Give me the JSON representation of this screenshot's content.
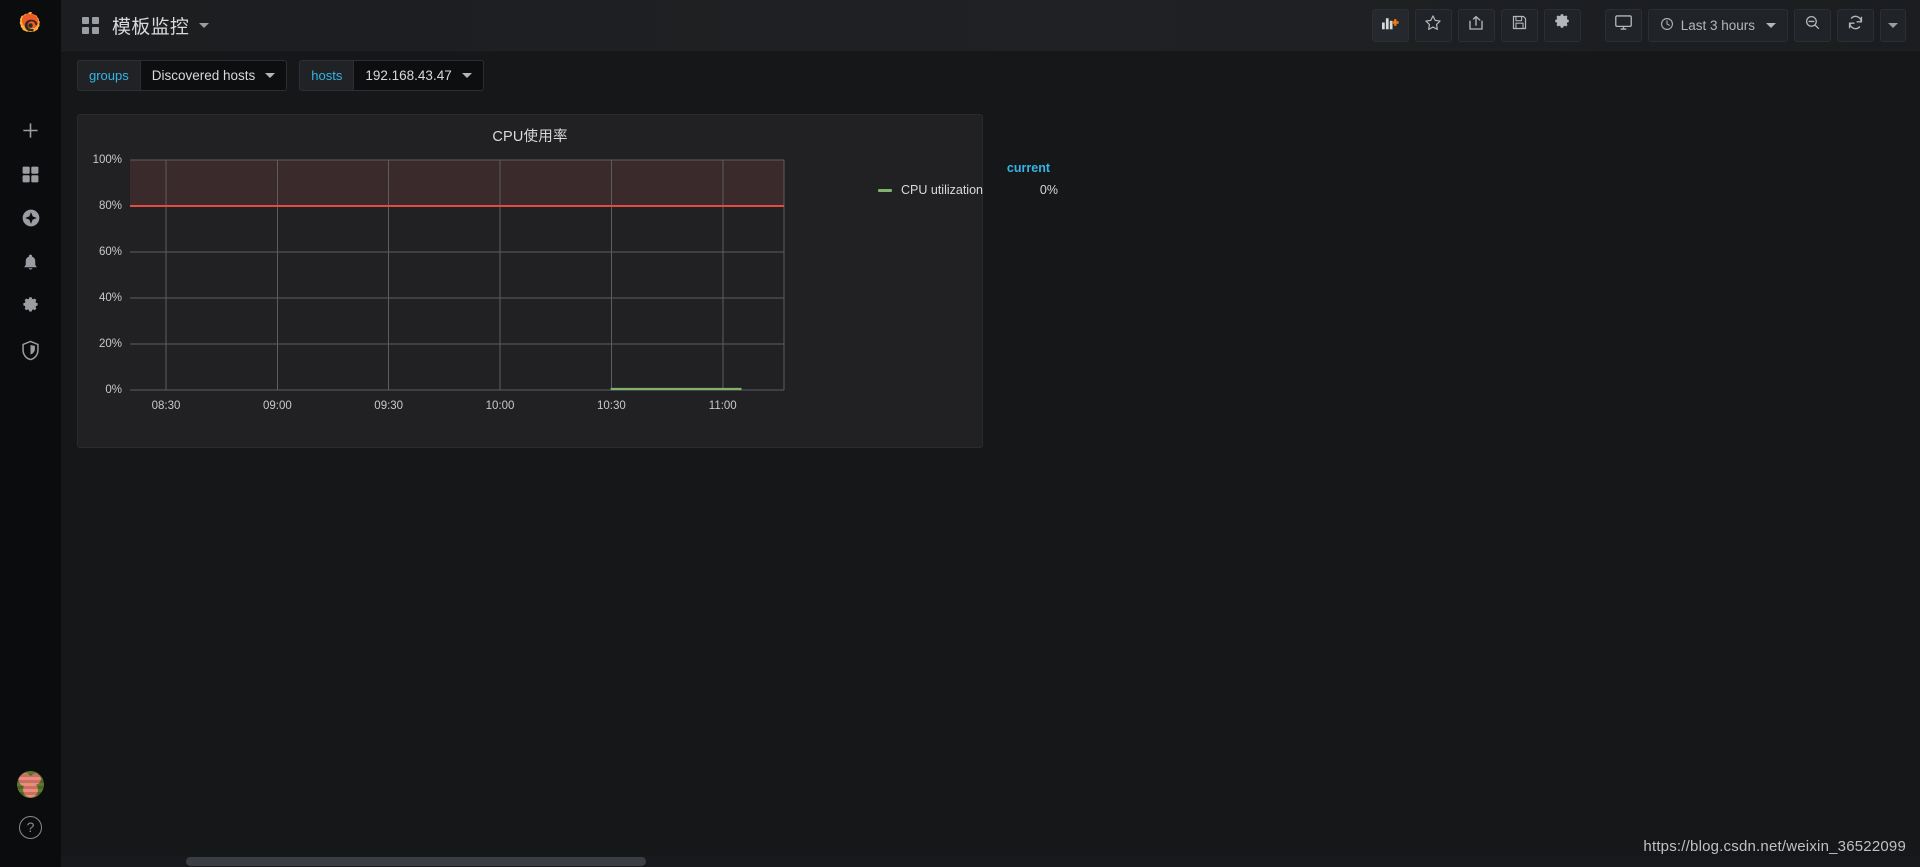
{
  "app": {
    "logo_icon": "grafana-logo-icon",
    "brand_colors": {
      "orange": "#f05a28",
      "yellow": "#fbb03b"
    }
  },
  "sidebar": {
    "items": [
      {
        "id": "create",
        "icon": "plus-icon",
        "label": "Create"
      },
      {
        "id": "dashboards",
        "icon": "dashboards-grid-icon",
        "label": "Dashboards"
      },
      {
        "id": "explore",
        "icon": "compass-icon",
        "label": "Explore"
      },
      {
        "id": "alerting",
        "icon": "bell-icon",
        "label": "Alerting"
      },
      {
        "id": "configuration",
        "icon": "gear-icon",
        "label": "Configuration"
      },
      {
        "id": "server-admin",
        "icon": "shield-icon",
        "label": "Server Admin"
      }
    ],
    "bottom": {
      "avatar": {
        "icon": "avatar",
        "label": "User profile"
      },
      "help": {
        "icon": "help-icon",
        "label": "?"
      }
    }
  },
  "topnav": {
    "dashboard_icon": "dashboards-grid-icon",
    "title": "模板监控",
    "title_caret_icon": "chevron-down-icon",
    "buttons": [
      {
        "id": "add-panel",
        "icon": "add-panel-icon",
        "label": "Add panel"
      },
      {
        "id": "star",
        "icon": "star-icon",
        "label": "Mark as favorite"
      },
      {
        "id": "share",
        "icon": "share-icon",
        "label": "Share dashboard"
      },
      {
        "id": "save",
        "icon": "save-icon",
        "label": "Save dashboard"
      },
      {
        "id": "settings",
        "icon": "gear-icon",
        "label": "Dashboard settings"
      },
      {
        "id": "kiosk",
        "icon": "monitor-icon",
        "label": "Cycle view mode"
      }
    ],
    "timepicker": {
      "clock_icon": "clock-icon",
      "range_label": "Last 3 hours",
      "caret_icon": "chevron-down-icon"
    },
    "zoom_out": {
      "icon": "zoom-out-icon",
      "label": "Zoom out time range"
    },
    "refresh": {
      "icon": "refresh-icon",
      "label": "Refresh dashboard"
    },
    "refresh_interval_caret": {
      "icon": "chevron-down-icon",
      "label": "Refresh interval"
    }
  },
  "submenu": {
    "variables": [
      {
        "name": "groups",
        "value": "Discovered hosts",
        "caret_icon": "chevron-down-icon"
      },
      {
        "name": "hosts",
        "value": "192.168.43.47",
        "caret_icon": "chevron-down-icon"
      }
    ]
  },
  "panel": {
    "title": "CPU使用率",
    "legend": {
      "header": "current",
      "series": [
        {
          "name": "CPU utilization",
          "value": "0%",
          "color": "#7eb26d"
        }
      ]
    }
  },
  "chart_data": {
    "type": "line",
    "title": "CPU使用率",
    "xlabel": "",
    "ylabel": "",
    "x_tick_labels": [
      "08:30",
      "09:00",
      "09:30",
      "10:00",
      "10:30",
      "11:00"
    ],
    "y_tick_labels": [
      "0%",
      "20%",
      "40%",
      "60%",
      "80%",
      "100%"
    ],
    "y_ticks": [
      0,
      20,
      40,
      60,
      80,
      100
    ],
    "ylim": [
      0,
      100
    ],
    "grid": true,
    "legend_position": "right",
    "threshold": {
      "value": 80,
      "op": "gt",
      "line_color": "#e24d42",
      "fill_color": "#3b2a2c",
      "fill_to": 100
    },
    "series": [
      {
        "name": "CPU utilization",
        "color": "#7eb26d",
        "current": 0,
        "unit": "percent",
        "x": [
          "10:36",
          "10:42",
          "10:48",
          "10:54",
          "11:00",
          "11:06"
        ],
        "values": [
          0,
          0,
          0,
          0,
          0,
          0
        ]
      }
    ]
  },
  "watermark": {
    "text": "https://blog.csdn.net/weixin_36522099"
  }
}
